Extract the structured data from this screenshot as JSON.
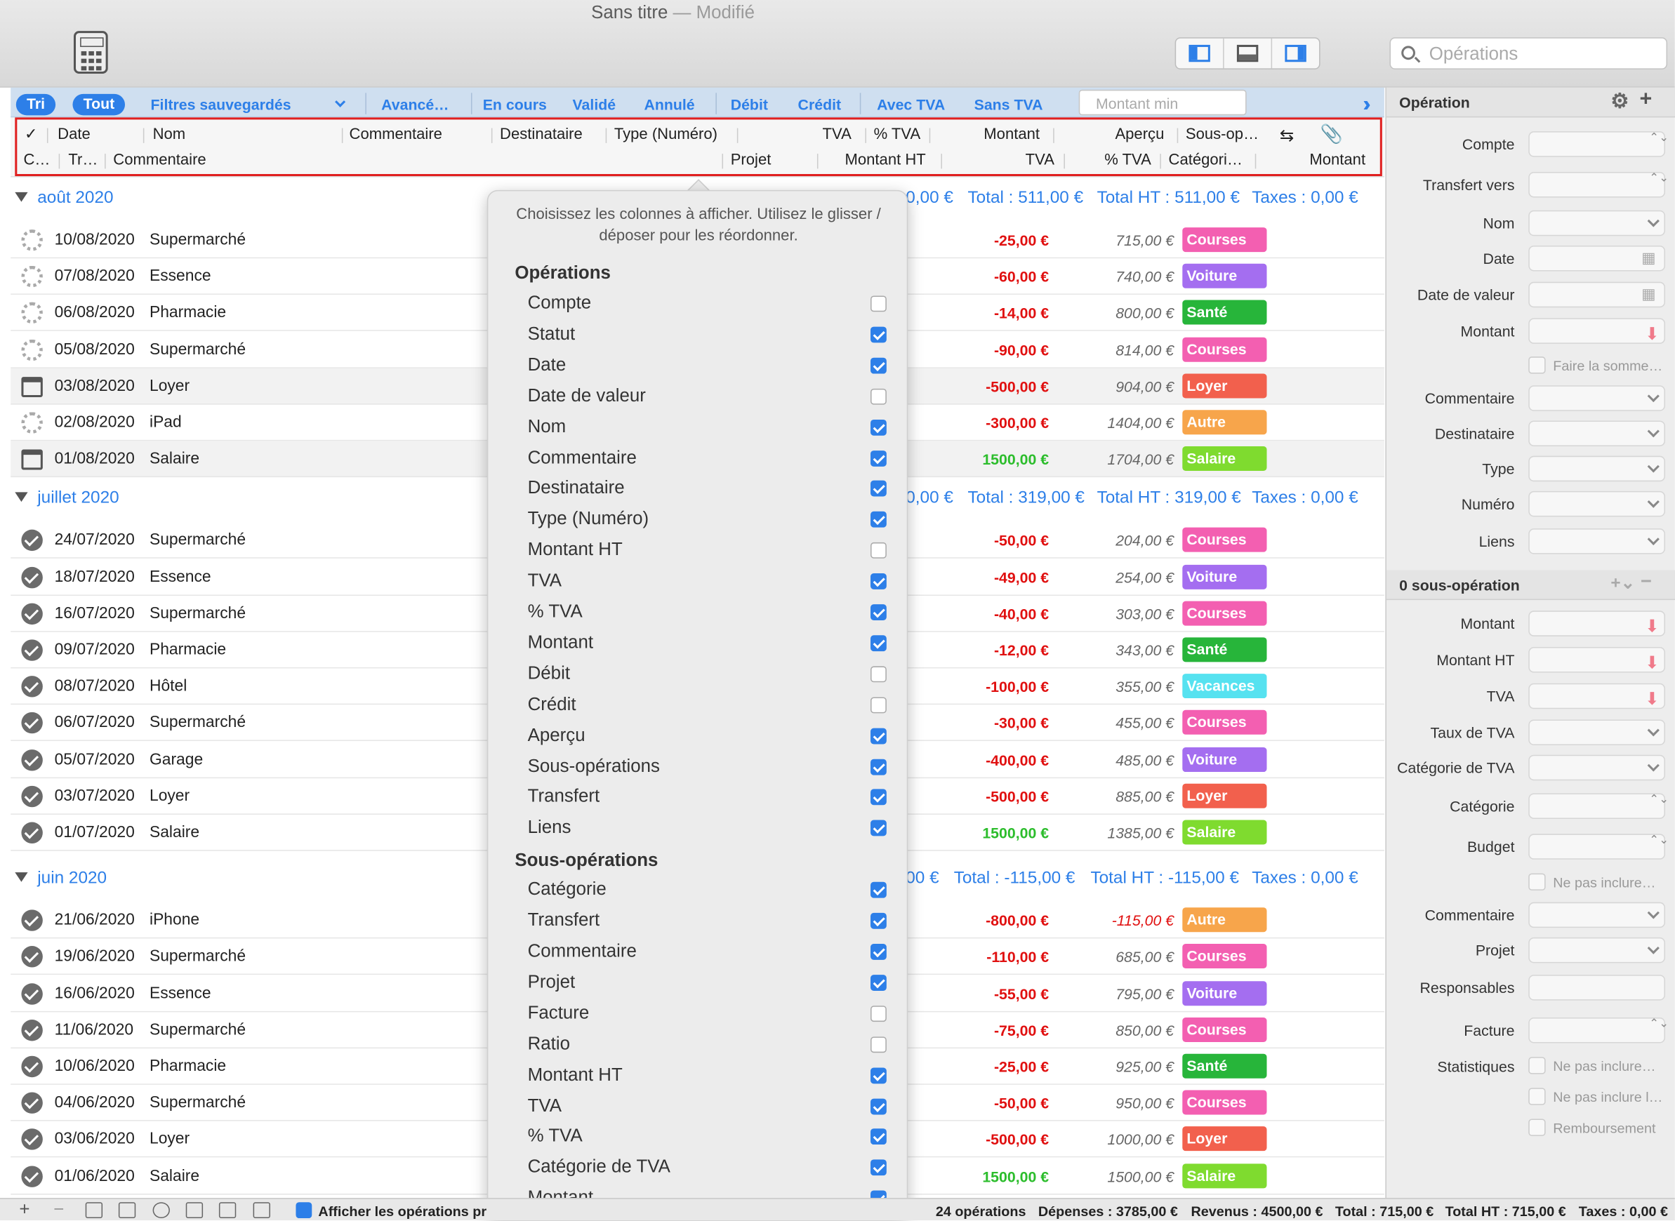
{
  "window": {
    "title": "Sans titre",
    "modified": "— Modifié"
  },
  "search": {
    "placeholder": "Opérations"
  },
  "filters": {
    "sort": "Tri",
    "all": "Tout",
    "saved": "Filtres sauvegardés",
    "advanced": "Avancé…",
    "in_progress": "En cours",
    "validated": "Validé",
    "cancelled": "Annulé",
    "debit": "Débit",
    "credit": "Crédit",
    "with_vat": "Avec TVA",
    "without_vat": "Sans TVA",
    "min_amount": "Montant min"
  },
  "header": {
    "row1": [
      "✓",
      "Date",
      "Nom",
      "Commentaire",
      "Destinataire",
      "Type (Numéro)",
      "TVA",
      "% TVA",
      "Montant",
      "Aperçu",
      "Sous-op…"
    ],
    "row2": [
      "C…",
      "Tr…",
      "Commentaire",
      "Projet",
      "Montant HT",
      "TVA",
      "% TVA",
      "Catégori…",
      "Montant"
    ]
  },
  "groups": [
    {
      "label": "août 2020",
      "sum": "0,00 €",
      "total": "Total : 511,00 €",
      "total_ht": "Total HT : 511,00 €",
      "taxes": "Taxes : 0,00 €",
      "rows": [
        {
          "status": "pending",
          "date": "10/08/2020",
          "name": "Supermarché",
          "amount": "-25,00 €",
          "balance": "715,00 €",
          "category": "Courses",
          "color": "#f35fb1"
        },
        {
          "status": "pending",
          "date": "07/08/2020",
          "name": "Essence",
          "amount": "-60,00 €",
          "balance": "740,00 €",
          "category": "Voiture",
          "color": "#a46ef0"
        },
        {
          "status": "pending",
          "date": "06/08/2020",
          "name": "Pharmacie",
          "amount": "-14,00 €",
          "balance": "800,00 €",
          "category": "Santé",
          "color": "#27b53a"
        },
        {
          "status": "pending",
          "date": "05/08/2020",
          "name": "Supermarché",
          "amount": "-90,00 €",
          "balance": "814,00 €",
          "category": "Courses",
          "color": "#f35fb1"
        },
        {
          "status": "scheduled",
          "date": "03/08/2020",
          "name": "Loyer",
          "amount": "-500,00 €",
          "balance": "904,00 €",
          "category": "Loyer",
          "color": "#f2604d"
        },
        {
          "status": "pending",
          "date": "02/08/2020",
          "name": "iPad",
          "amount": "-300,00 €",
          "balance": "1404,00 €",
          "category": "Autre",
          "color": "#f7a54b"
        },
        {
          "status": "scheduled",
          "date": "01/08/2020",
          "name": "Salaire",
          "amount": "1500,00 €",
          "balance": "1704,00 €",
          "category": "Salaire",
          "color": "#7fdb2f"
        }
      ]
    },
    {
      "label": "juillet 2020",
      "sum": "0,00 €",
      "total": "Total : 319,00 €",
      "total_ht": "Total HT : 319,00 €",
      "taxes": "Taxes : 0,00 €",
      "rows": [
        {
          "status": "ok",
          "date": "24/07/2020",
          "name": "Supermarché",
          "amount": "-50,00 €",
          "balance": "204,00 €",
          "category": "Courses",
          "color": "#f35fb1"
        },
        {
          "status": "ok",
          "date": "18/07/2020",
          "name": "Essence",
          "amount": "-49,00 €",
          "balance": "254,00 €",
          "category": "Voiture",
          "color": "#a46ef0"
        },
        {
          "status": "ok",
          "date": "16/07/2020",
          "name": "Supermarché",
          "amount": "-40,00 €",
          "balance": "303,00 €",
          "category": "Courses",
          "color": "#f35fb1"
        },
        {
          "status": "ok",
          "date": "09/07/2020",
          "name": "Pharmacie",
          "amount": "-12,00 €",
          "balance": "343,00 €",
          "category": "Santé",
          "color": "#27b53a"
        },
        {
          "status": "ok",
          "date": "08/07/2020",
          "name": "Hôtel",
          "amount": "-100,00 €",
          "balance": "355,00 €",
          "category": "Vacances",
          "color": "#56e2f0"
        },
        {
          "status": "ok",
          "date": "06/07/2020",
          "name": "Supermarché",
          "amount": "-30,00 €",
          "balance": "455,00 €",
          "category": "Courses",
          "color": "#f35fb1"
        },
        {
          "status": "ok",
          "date": "05/07/2020",
          "name": "Garage",
          "amount": "-400,00 €",
          "balance": "485,00 €",
          "category": "Voiture",
          "color": "#a46ef0"
        },
        {
          "status": "ok",
          "date": "03/07/2020",
          "name": "Loyer",
          "amount": "-500,00 €",
          "balance": "885,00 €",
          "category": "Loyer",
          "color": "#f2604d"
        },
        {
          "status": "ok",
          "date": "01/07/2020",
          "name": "Salaire",
          "amount": "1500,00 €",
          "balance": "1385,00 €",
          "category": "Salaire",
          "color": "#7fdb2f"
        }
      ]
    },
    {
      "label": "juin 2020",
      "sum": "00 €",
      "total": "Total : -115,00 €",
      "total_ht": "Total HT : -115,00 €",
      "taxes": "Taxes : 0,00 €",
      "rows": [
        {
          "status": "ok",
          "date": "21/06/2020",
          "name": "iPhone",
          "amount": "-800,00 €",
          "balance": "-115,00 €",
          "category": "Autre",
          "color": "#f7a54b"
        },
        {
          "status": "ok",
          "date": "19/06/2020",
          "name": "Supermarché",
          "amount": "-110,00 €",
          "balance": "685,00 €",
          "category": "Courses",
          "color": "#f35fb1"
        },
        {
          "status": "ok",
          "date": "16/06/2020",
          "name": "Essence",
          "amount": "-55,00 €",
          "balance": "795,00 €",
          "category": "Voiture",
          "color": "#a46ef0"
        },
        {
          "status": "ok",
          "date": "11/06/2020",
          "name": "Supermarché",
          "amount": "-75,00 €",
          "balance": "850,00 €",
          "category": "Courses",
          "color": "#f35fb1"
        },
        {
          "status": "ok",
          "date": "10/06/2020",
          "name": "Pharmacie",
          "amount": "-25,00 €",
          "balance": "925,00 €",
          "category": "Santé",
          "color": "#27b53a"
        },
        {
          "status": "ok",
          "date": "04/06/2020",
          "name": "Supermarché",
          "amount": "-50,00 €",
          "balance": "950,00 €",
          "category": "Courses",
          "color": "#f35fb1"
        },
        {
          "status": "ok",
          "date": "03/06/2020",
          "name": "Loyer",
          "amount": "-500,00 €",
          "balance": "1000,00 €",
          "category": "Loyer",
          "color": "#f2604d"
        },
        {
          "status": "ok",
          "date": "01/06/2020",
          "name": "Salaire",
          "amount": "1500,00 €",
          "balance": "1500,00 €",
          "category": "Salaire",
          "color": "#7fdb2f"
        }
      ]
    }
  ],
  "popover": {
    "help": "Choisissez les colonnes à afficher. Utilisez le glisser / déposer pour les réordonner.",
    "section1": "Opérations",
    "items1": [
      [
        "Compte",
        false
      ],
      [
        "Statut",
        true
      ],
      [
        "Date",
        true
      ],
      [
        "Date de valeur",
        false
      ],
      [
        "Nom",
        true
      ],
      [
        "Commentaire",
        true
      ],
      [
        "Destinataire",
        true
      ],
      [
        "Type (Numéro)",
        true
      ],
      [
        "Montant HT",
        false
      ],
      [
        "TVA",
        true
      ],
      [
        "% TVA",
        true
      ],
      [
        "Montant",
        true
      ],
      [
        "Débit",
        false
      ],
      [
        "Crédit",
        false
      ],
      [
        "Aperçu",
        true
      ],
      [
        "Sous-opérations",
        true
      ],
      [
        "Transfert",
        true
      ],
      [
        "Liens",
        true
      ]
    ],
    "section2": "Sous-opérations",
    "items2": [
      [
        "Catégorie",
        true
      ],
      [
        "Transfert",
        true
      ],
      [
        "Commentaire",
        true
      ],
      [
        "Projet",
        true
      ],
      [
        "Facture",
        false
      ],
      [
        "Ratio",
        false
      ],
      [
        "Montant HT",
        true
      ],
      [
        "TVA",
        true
      ],
      [
        "% TVA",
        true
      ],
      [
        "Catégorie de TVA",
        true
      ],
      [
        "Montant",
        true
      ]
    ]
  },
  "inspector": {
    "title": "Opération",
    "fields": [
      "Compte",
      "Transfert vers",
      "Nom",
      "Date",
      "Date de valeur",
      "Montant"
    ],
    "sum_check": "Faire la somme…",
    "fields2": [
      "Commentaire",
      "Destinataire",
      "Type",
      "Numéro",
      "Liens"
    ],
    "sub_title": "0 sous-opération",
    "sub_fields": [
      "Montant",
      "Montant HT",
      "TVA",
      "Taux de TVA",
      "Catégorie de TVA",
      "Catégorie",
      "Budget"
    ],
    "not_include": "Ne pas inclure…",
    "sub_fields2": [
      "Commentaire",
      "Projet",
      "Responsables",
      "Facture"
    ],
    "stats": "Statistiques",
    "stat_checks": [
      "Ne pas inclure…",
      "Ne pas inclure l…",
      "Remboursement"
    ]
  },
  "footer": {
    "show_ops": "Afficher les opérations pr",
    "count": "24 opérations",
    "expenses": "Dépenses : 3785,00 €",
    "income": "Revenus : 4500,00 €",
    "total": "Total : 715,00 €",
    "total_ht": "Total HT : 715,00 €",
    "taxes": "Taxes : 0,00 €"
  }
}
